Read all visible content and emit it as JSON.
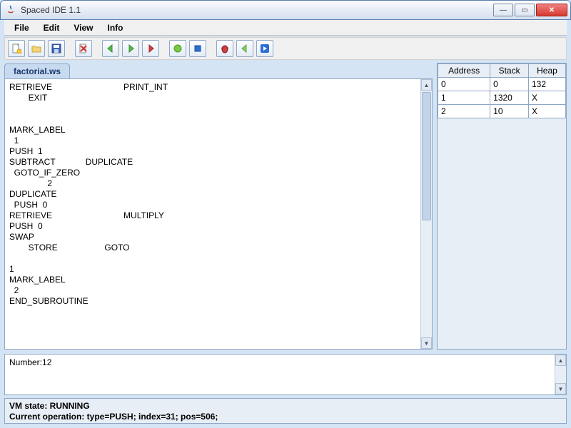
{
  "window": {
    "title": "Spaced IDE 1.1"
  },
  "menu": {
    "file": "File",
    "edit": "Edit",
    "view": "View",
    "info": "Info"
  },
  "tabs": [
    {
      "label": "factorial.ws"
    }
  ],
  "editor": {
    "content": "RETRIEVE\t\t\t\tPRINT_INT\n\tEXIT\n\n\nMARK_LABEL\n  1\nPUSH  1\nSUBTRACT\t\tDUPLICATE\n  GOTO_IF_ZERO\n\t\t2\nDUPLICATE\n  PUSH  0\nRETRIEVE\t\t\t\tMULTIPLY\nPUSH  0\nSWAP\n\tSTORE\t\t\tGOTO\n\n1\nMARK_LABEL\n  2\nEND_SUBROUTINE"
  },
  "memory": {
    "headers": {
      "address": "Address",
      "stack": "Stack",
      "heap": "Heap"
    },
    "rows": [
      {
        "address": "0",
        "stack": "0",
        "heap": "132"
      },
      {
        "address": "1",
        "stack": "1320",
        "heap": "X"
      },
      {
        "address": "2",
        "stack": "10",
        "heap": "X"
      }
    ]
  },
  "output": {
    "text": "Number:12"
  },
  "status": {
    "vm_state": "VM state: RUNNING",
    "current_op": "Current operation: type=PUSH; index=31; pos=506;"
  }
}
